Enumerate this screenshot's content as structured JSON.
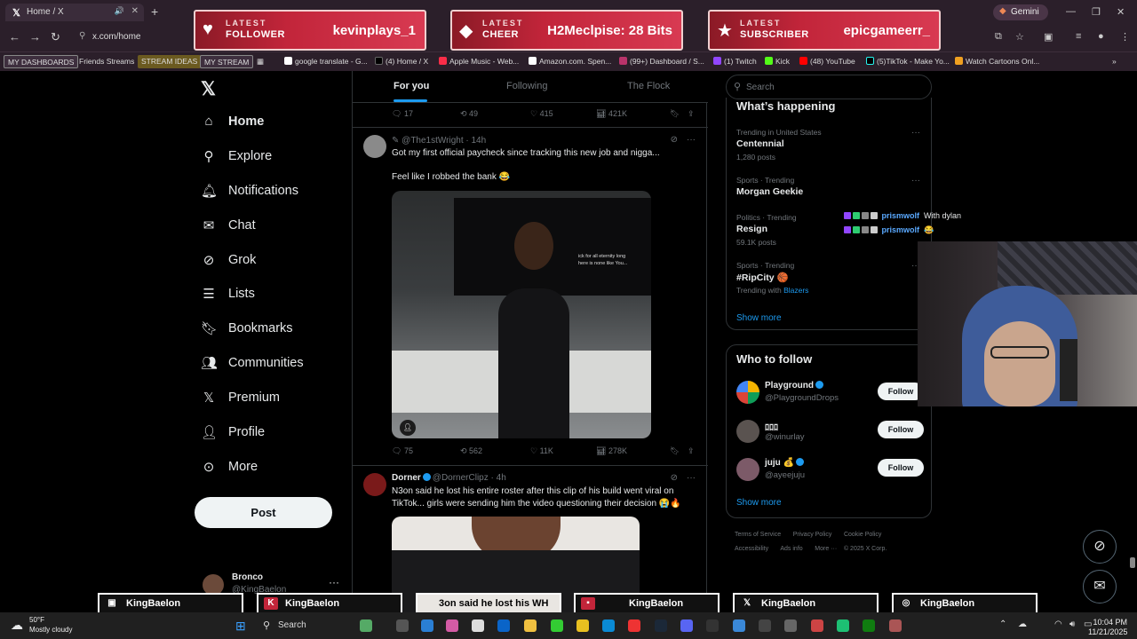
{
  "browser": {
    "tab_title": "Home / X",
    "url": "x.com/home",
    "gemini_label": "Gemini",
    "bookmarks": [
      "MY DASHBOARDS",
      "Friends Streams",
      "STREAM IDEAS",
      "MY STREAM",
      "google translate - G...",
      "(4) Home / X",
      "Apple Music - Web...",
      "Amazon.com. Spen...",
      "(99+) Dashboard / S...",
      "(1) Twitch",
      "Kick",
      "(48) YouTube",
      "(5)TikTok - Make Yo...",
      "Watch Cartoons Onl..."
    ]
  },
  "alerts": [
    {
      "line1": "LATEST",
      "line2": "FOLLOWER",
      "value": "kevinplays_1",
      "icon": "heart-icon"
    },
    {
      "line1": "LATEST",
      "line2": "CHEER",
      "value": "H2Meclpise: 28 Bits",
      "icon": "diamond-icon"
    },
    {
      "line1": "LATEST",
      "line2": "SUBSCRIBER",
      "value": "epicgameerr_",
      "icon": "star-icon"
    }
  ],
  "sidebar": {
    "items": [
      {
        "label": "Home",
        "icon": "home-icon"
      },
      {
        "label": "Explore",
        "icon": "search-icon"
      },
      {
        "label": "Notifications",
        "icon": "bell-icon"
      },
      {
        "label": "Chat",
        "icon": "mail-icon"
      },
      {
        "label": "Grok",
        "icon": "grok-icon"
      },
      {
        "label": "Lists",
        "icon": "list-icon"
      },
      {
        "label": "Bookmarks",
        "icon": "bookmark-icon"
      },
      {
        "label": "Communities",
        "icon": "communities-icon"
      },
      {
        "label": "Premium",
        "icon": "x-icon"
      },
      {
        "label": "Profile",
        "icon": "person-icon"
      },
      {
        "label": "More",
        "icon": "more-icon"
      }
    ],
    "post_label": "Post",
    "account": {
      "name": "Bronco",
      "handle": "@KingBaelon"
    }
  },
  "feed": {
    "tabs": [
      "For you",
      "Following",
      "The Flock"
    ],
    "prev_actions": {
      "replies": "17",
      "reposts": "49",
      "likes": "415",
      "views": "421K"
    },
    "tweet1": {
      "handle": "@The1stWright",
      "time": "14h",
      "text1": "Got my first official paycheck since tracking this new job and nigga...",
      "text2": "Feel like I robbed the bank 😂",
      "video_caption": "ick for all eternity long\nhere is none like You...",
      "actions": {
        "replies": "75",
        "reposts": "562",
        "likes": "11K",
        "views": "278K"
      }
    },
    "tweet2": {
      "name": "Dorner",
      "handle": "@DornerClipz",
      "time": "4h",
      "text": "N3on said he lost his entire roster after this clip of his build went viral on TikTok... girls were sending him the video questioning their decision 😭🔥"
    }
  },
  "right": {
    "search_placeholder": "Search",
    "happening_title": "What’s happening",
    "trends": [
      {
        "cat": "Trending in United States",
        "name": "Centennial",
        "sub": "1,280 posts"
      },
      {
        "cat": "Sports · Trending",
        "name": "Morgan Geekie",
        "sub": ""
      },
      {
        "cat": "Politics · Trending",
        "name": "Resign",
        "sub": "59.1K posts"
      },
      {
        "cat": "Sports · Trending",
        "name": "#RipCity 🏀",
        "sub": "Trending with ",
        "sub_link": "Blazers"
      }
    ],
    "show_more": "Show more",
    "who_title": "Who to follow",
    "follow": [
      {
        "name": "Playground",
        "handle": "@PlaygroundDrops",
        "verified": true
      },
      {
        "name": "ﾛﾛﾛ",
        "handle": "@winurlay",
        "verified": false
      },
      {
        "name": "juju 💰",
        "handle": "@ayeejuju",
        "verified": true
      }
    ],
    "follow_label": "Follow",
    "footer1": [
      "Terms of Service",
      "|",
      "Privacy Policy",
      "|",
      "Cookie Policy",
      "|"
    ],
    "footer2": [
      "Accessibility",
      "Ads info",
      "More ···",
      "© 2025 X Corp."
    ]
  },
  "chat": [
    {
      "user": "prismwolf",
      "msg": "With dylan"
    },
    {
      "user": "prismwolf",
      "msg": "😂"
    }
  ],
  "overlay": {
    "nameplates": [
      "KingBaelon",
      "KingBaelon",
      "3on said he lost his WH",
      "KingBaelon",
      "KingBaelon",
      "KingBaelon"
    ]
  },
  "taskbar": {
    "temp": "50°F",
    "weather": "Mostly cloudy",
    "search": "Search",
    "time": "10:04 PM",
    "date": "11/21/2025"
  },
  "colors": {
    "accent": "#1d9bf0",
    "alert_red": "#c2253a",
    "background": "#000000"
  }
}
